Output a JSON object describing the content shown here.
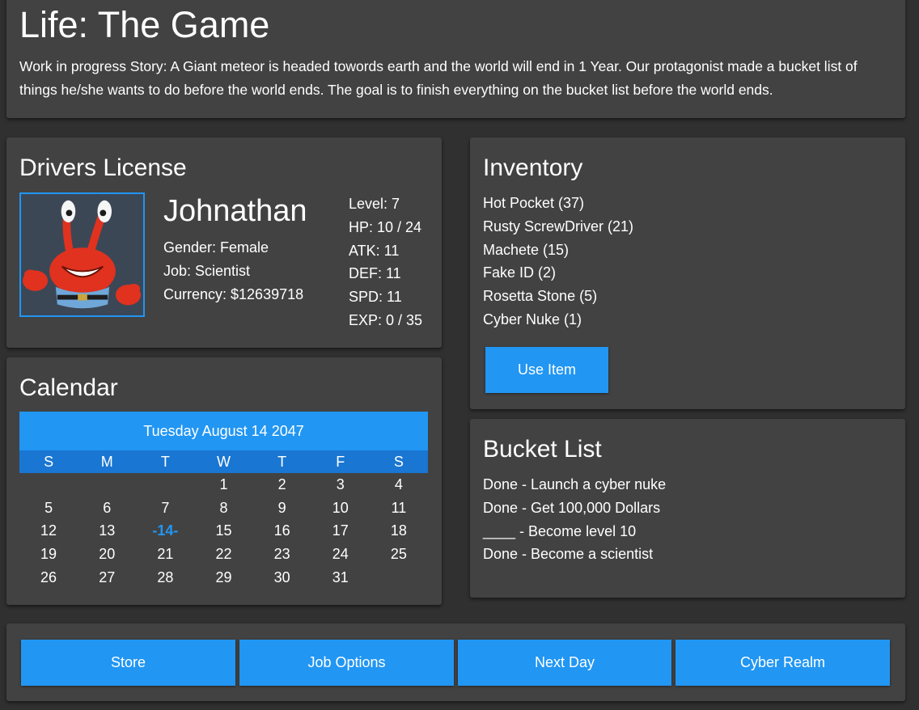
{
  "header": {
    "title": "Life: The Game",
    "story": "Work in progress Story: A Giant meteor is headed towords earth and the world will end in 1 Year. Our protagonist made a bucket list of things he/she wants to do before the world ends. The goal is to finish everything on the bucket list before the world ends."
  },
  "license": {
    "heading": "Drivers License",
    "name": "Johnathan",
    "gender": "Gender: Female",
    "job": "Job: Scientist",
    "currency": "Currency: $12639718",
    "stats": {
      "level": "Level: 7",
      "hp": "HP: 10 / 24",
      "atk": "ATK: 11",
      "def": "DEF: 11",
      "spd": "SPD: 11",
      "exp": "EXP: 0 / 35"
    }
  },
  "calendar": {
    "heading": "Calendar",
    "date": "Tuesday August 14 2047",
    "weekdays": [
      "S",
      "M",
      "T",
      "W",
      "T",
      "F",
      "S"
    ],
    "weeks": [
      [
        "",
        "",
        "",
        "1",
        "2",
        "3",
        "4"
      ],
      [
        "5",
        "6",
        "7",
        "8",
        "9",
        "10",
        "11"
      ],
      [
        "12",
        "13",
        "-14-",
        "15",
        "16",
        "17",
        "18"
      ],
      [
        "19",
        "20",
        "21",
        "22",
        "23",
        "24",
        "25"
      ],
      [
        "26",
        "27",
        "28",
        "29",
        "30",
        "31",
        ""
      ]
    ]
  },
  "inventory": {
    "heading": "Inventory",
    "items": [
      "Hot Pocket (37)",
      "Rusty ScrewDriver (21)",
      "Machete (15)",
      "Fake ID (2)",
      "Rosetta Stone (5)",
      "Cyber Nuke (1)"
    ],
    "use_label": "Use Item"
  },
  "bucket": {
    "heading": "Bucket List",
    "items": [
      "Done - Launch a cyber nuke",
      "Done - Get 100,000 Dollars",
      "____ - Become level 10",
      "Done - Become a scientist"
    ]
  },
  "actions": {
    "store": "Store",
    "job_options": "Job Options",
    "next_day": "Next Day",
    "cyber_realm": "Cyber Realm"
  },
  "colors": {
    "background": "#303030",
    "card": "#424242",
    "accent": "#2196f3",
    "accent_dark": "#1976d2"
  },
  "icons": {
    "avatar": "crab-character-portrait"
  }
}
